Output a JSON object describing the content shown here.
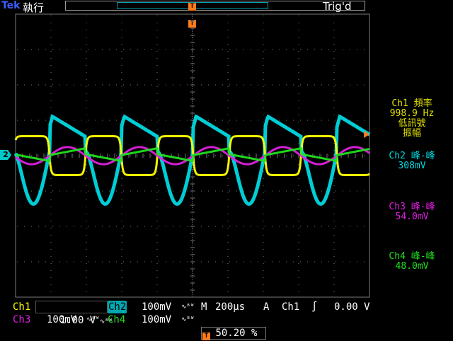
{
  "header": {
    "brand": "Tek",
    "run_state": "執行",
    "trigger_status": "Trig'd",
    "trigger_marker": "T"
  },
  "channel_markers": {
    "ch2": "2"
  },
  "colors": {
    "ch1": "#ffff00",
    "ch2": "#00d8e0",
    "ch3": "#e020e0",
    "ch4": "#20e020",
    "grid": "#7a7a7a",
    "trigger": "#ff7a1a"
  },
  "measurements": [
    {
      "channel": "Ch1",
      "label": "頻率",
      "value": "998.9 Hz",
      "note": "低訊號\n振幅",
      "color": "#e0e000"
    },
    {
      "channel": "Ch2",
      "label": "峰-峰",
      "value": "308mV",
      "note": "",
      "color": "#00d8e0"
    },
    {
      "channel": "Ch3",
      "label": "峰-峰",
      "value": "54.0mV",
      "note": "",
      "color": "#e020e0"
    },
    {
      "channel": "Ch4",
      "label": "峰-峰",
      "value": "48.0mV",
      "note": "",
      "color": "#20e020"
    }
  ],
  "vertical_settings": [
    {
      "name": "Ch1",
      "scale": "1.00 V",
      "bw_icon": "bandwidth-limit-icon",
      "color": "#ffff00"
    },
    {
      "name": "Ch2",
      "scale": "100mV",
      "bw_icon": "bandwidth-limit-icon",
      "color": "#00d8e0"
    },
    {
      "name": "Ch3",
      "scale": "100mV",
      "bw_icon": "bandwidth-limit-icon",
      "color": "#e020e0"
    },
    {
      "name": "Ch4",
      "scale": "100mV",
      "bw_icon": "bandwidth-limit-icon",
      "color": "#20e020"
    }
  ],
  "horizontal": {
    "label": "M",
    "timebase": "200µs"
  },
  "trigger": {
    "mode": "A",
    "source": "Ch1",
    "slope_icon": "rising-edge-icon",
    "level": "0.00 V",
    "position_marker": "T",
    "position": "50.20 %"
  },
  "waveforms": {
    "period_divisions": 2.03,
    "ch1": {
      "offset_div": 0.6,
      "amplitude_div": 0.55
    },
    "ch2": {
      "offset_div": 0.0,
      "amplitude_div": 1.54
    },
    "ch3": {
      "offset_div": 0.0,
      "amplitude_div": 0.27
    },
    "ch4": {
      "offset_div": 0.05,
      "amplitude_div": 0.24
    }
  }
}
